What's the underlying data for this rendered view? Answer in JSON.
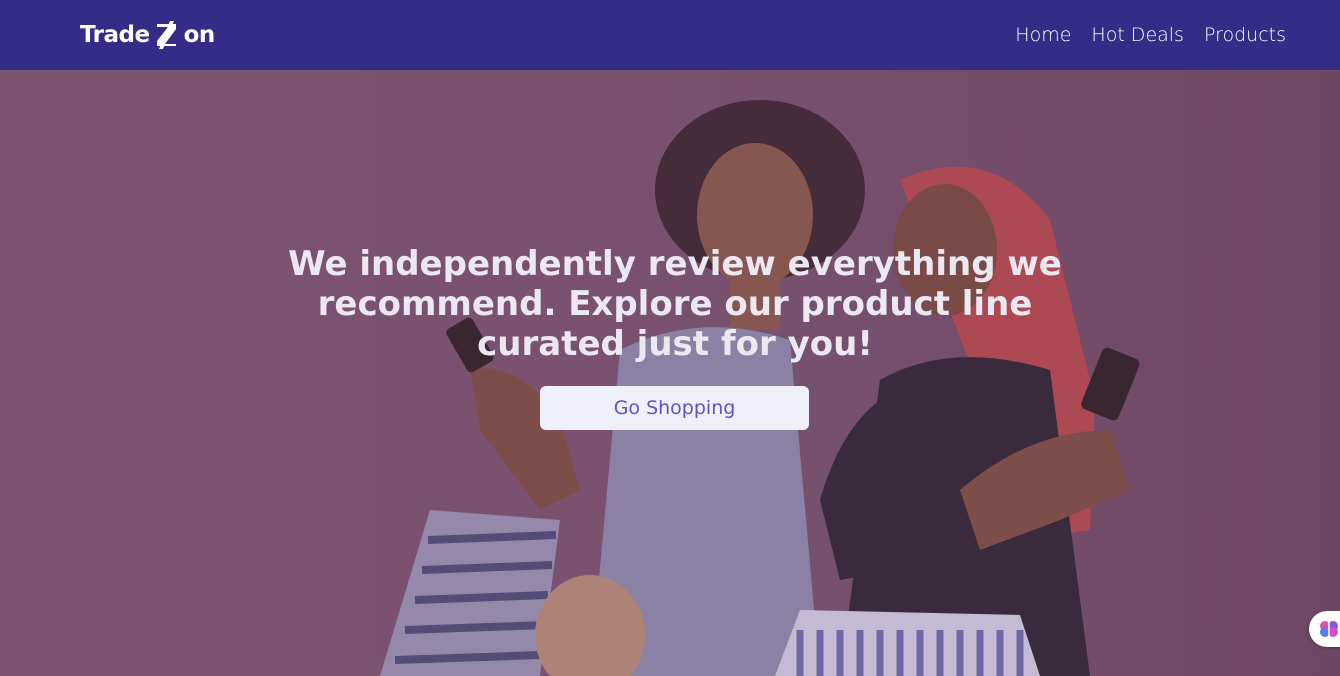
{
  "brand": {
    "name_part1": "Trade",
    "name_part2": "on"
  },
  "nav": {
    "items": [
      "Home",
      "Hot Deals",
      "Products"
    ]
  },
  "hero": {
    "headline": "We independently review everything we recommend. Explore our product line curated just for you!",
    "cta_label": "Go Shopping"
  },
  "icons": {
    "logo_mark": "slashed-z-icon",
    "widget": "brain-icon"
  },
  "colors": {
    "nav_bg": "#332d87",
    "cta_bg": "#eff0f9",
    "cta_text": "#5a55c9",
    "hero_bg": "#7b5570"
  }
}
